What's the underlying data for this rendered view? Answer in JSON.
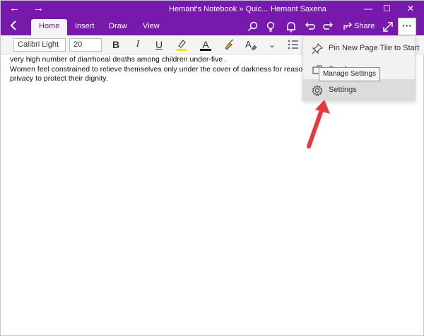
{
  "titlebar": {
    "back": "←",
    "forward": "→",
    "title": "Hemant's Notebook » Quic...",
    "user": "Hemant Saxena",
    "minimize": "—",
    "maximize": "☐",
    "close": "✕"
  },
  "tabs": [
    {
      "label": "Home",
      "active": true
    },
    {
      "label": "Insert",
      "active": false
    },
    {
      "label": "Draw",
      "active": false
    },
    {
      "label": "View",
      "active": false
    }
  ],
  "toolbar": {
    "share_label": "Share",
    "more_label": "···",
    "icons": [
      "search-icon",
      "lightbulb-icon",
      "bell-icon",
      "undo-icon",
      "redo-icon",
      "share-icon",
      "expand-icon"
    ]
  },
  "ribbon": {
    "font_name": "Calibri Light",
    "font_size": "20",
    "bold": "B",
    "italic": "I",
    "underline": "U",
    "font_color_letter": "A",
    "chevron": "⌄"
  },
  "document": {
    "lines": [
      "very high number of diarrhoeal deaths among children under-five .",
      "Women feel constrained to relieve themselves only under the cover of darkness for reasons of",
      "privacy to protect their dignity."
    ]
  },
  "menu": {
    "items": [
      {
        "label": "Pin New Page Tile to Start",
        "icon": "pin-icon"
      },
      {
        "label": "Send...",
        "icon": "send-icon"
      },
      {
        "label": "Settings",
        "icon": "gear-icon"
      }
    ],
    "tooltip": "Manage Settings"
  },
  "colors": {
    "brand": "#7719aa",
    "highlight": "#dcdcdc",
    "annotation_arrow": "#e8383d"
  }
}
